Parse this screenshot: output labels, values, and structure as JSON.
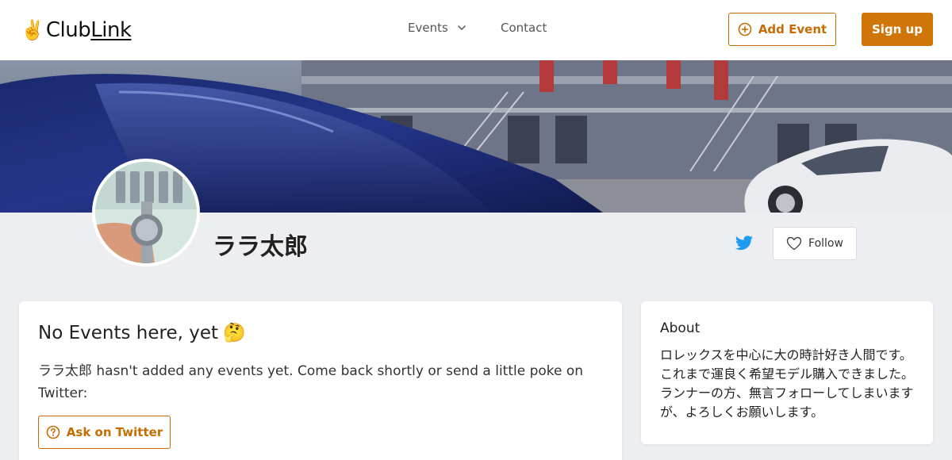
{
  "brand": {
    "name_plain": "Club",
    "name_underlined": "Link",
    "emoji": "✌️"
  },
  "nav": {
    "events_label": "Events",
    "contact_label": "Contact"
  },
  "header_actions": {
    "add_event_label": "Add Event",
    "signup_label": "Sign up"
  },
  "profile": {
    "name": "ララ太郎",
    "follow_label": "Follow"
  },
  "events_card": {
    "title": "No Events here, yet",
    "title_emoji": "🤔",
    "description": "ララ太郎 hasn't added any events yet. Come back shortly or send a little poke on Twitter:",
    "ask_label": "Ask on Twitter"
  },
  "about_card": {
    "title": "About",
    "body": "ロレックスを中心に大の時計好き人間です。これまで運良く希望モデル購入できました。ランナーの方、無言フォローしてしまいますが、よろしくお願いします。"
  },
  "colors": {
    "accent": "#d07508",
    "accent_outline": "#c66c00",
    "twitter": "#1d9bf0",
    "page_bg": "#edeef1"
  }
}
